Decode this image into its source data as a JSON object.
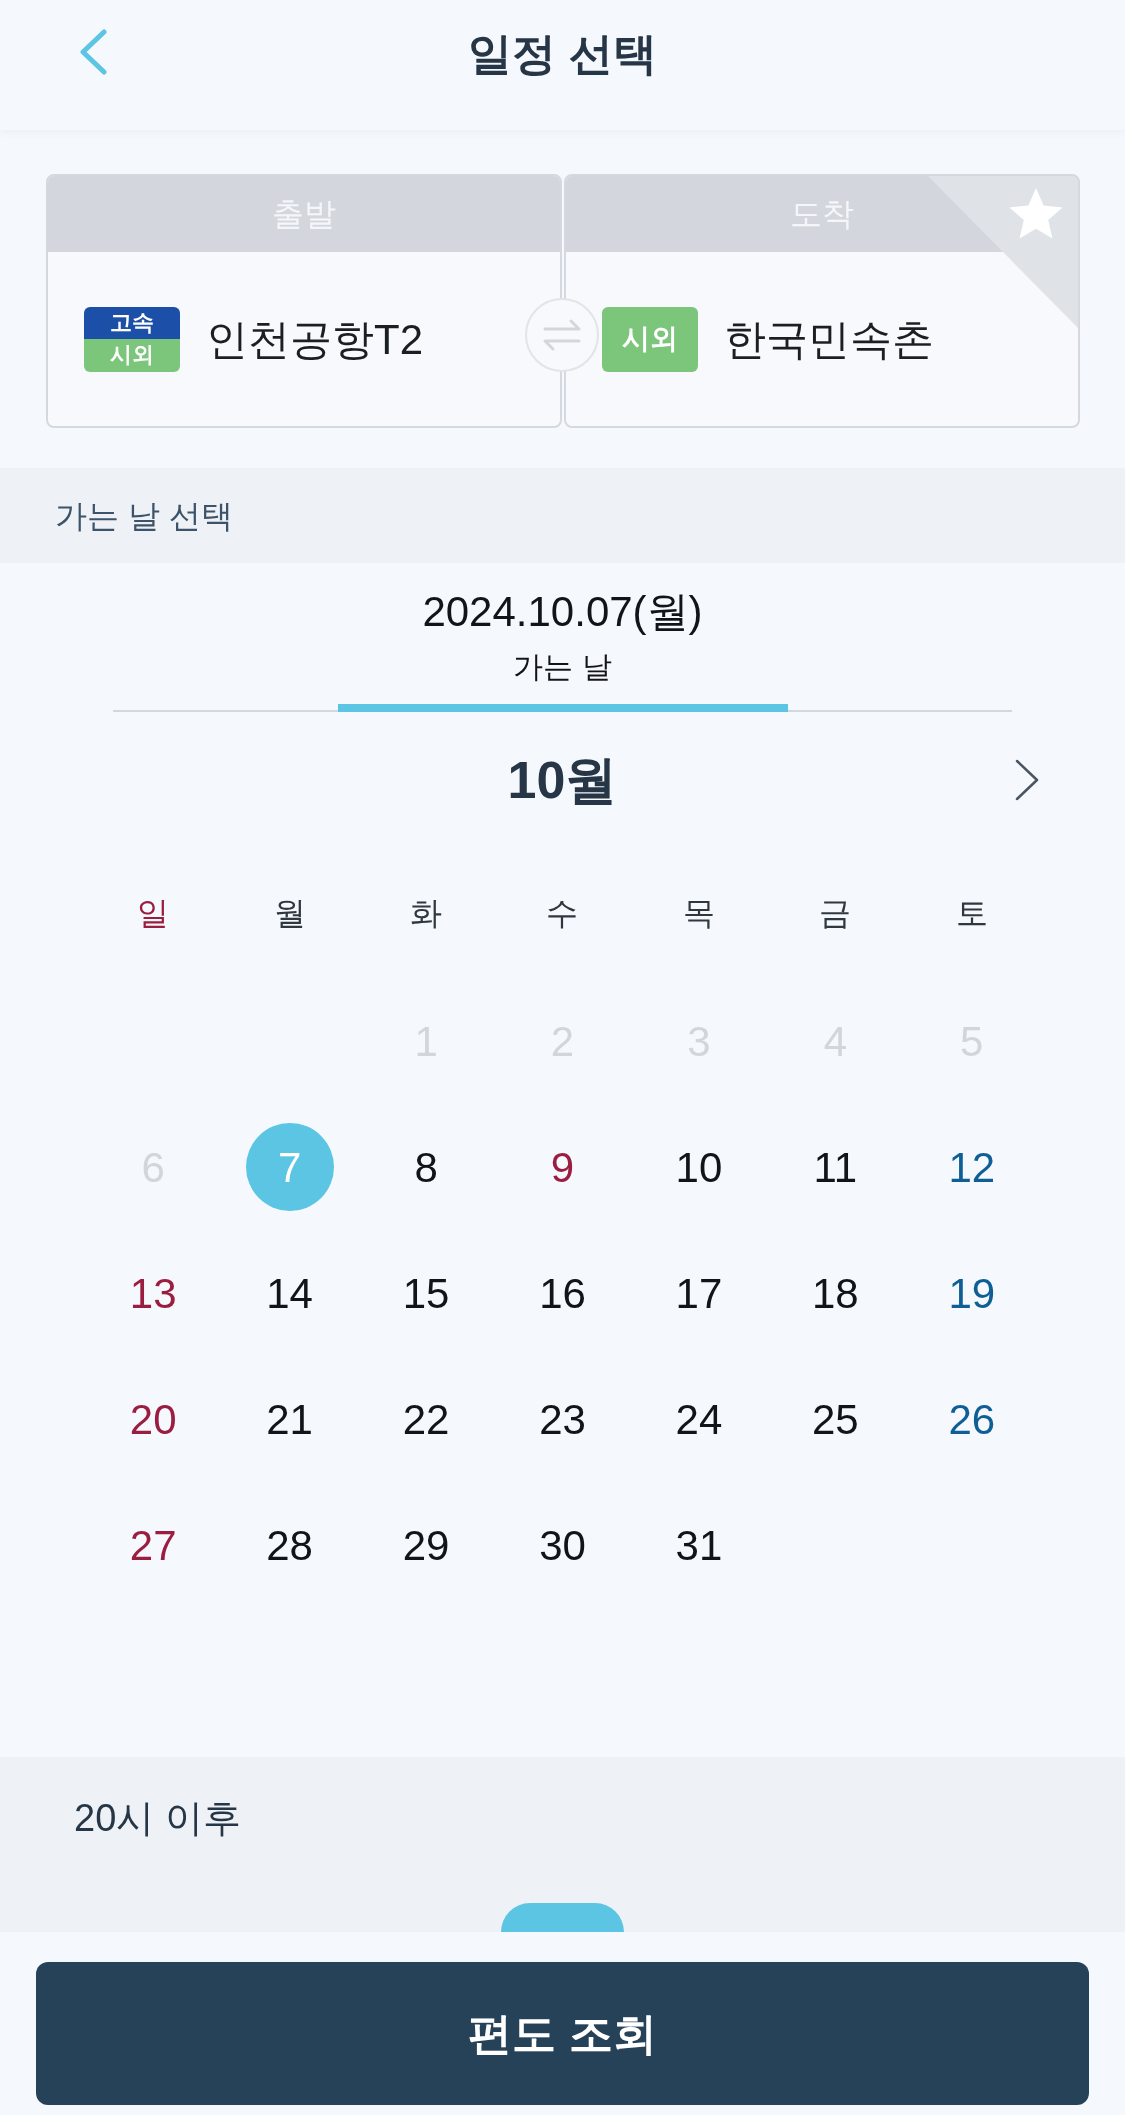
{
  "header": {
    "title": "일정 선택"
  },
  "route": {
    "departure": {
      "header": "출발",
      "name": "인천공항T2",
      "badges": [
        {
          "label": "고속",
          "color": "#1c4fa8"
        },
        {
          "label": "시외",
          "color": "#7cc67b"
        }
      ]
    },
    "arrival": {
      "header": "도착",
      "name": "한국민속촌",
      "badges": [
        {
          "label": "시외",
          "color": "#7cc67b"
        }
      ]
    },
    "favorite": false
  },
  "date_section": {
    "title": "가는 날 선택"
  },
  "date_tabs": [
    {
      "date": "2024.10.07(월)",
      "label": "가는 날",
      "selected": true
    }
  ],
  "calendar": {
    "month": "10월",
    "weekdays": [
      {
        "label": "일",
        "kind": "sunday"
      },
      {
        "label": "월",
        "kind": "weekday"
      },
      {
        "label": "화",
        "kind": "weekday"
      },
      {
        "label": "수",
        "kind": "weekday"
      },
      {
        "label": "목",
        "kind": "weekday"
      },
      {
        "label": "금",
        "kind": "weekday"
      },
      {
        "label": "토",
        "kind": "weekday"
      }
    ],
    "weeks": [
      {
        "days": [
          {
            "day": "1",
            "kind": "past",
            "selected": false
          },
          {
            "day": "2",
            "kind": "past",
            "selected": false
          },
          {
            "day": "3",
            "kind": "past",
            "selected": false
          },
          {
            "day": "4",
            "kind": "past",
            "selected": false
          },
          {
            "day": "5",
            "kind": "past",
            "selected": false
          }
        ]
      },
      {
        "days": [
          {
            "day": "6",
            "kind": "past",
            "selected": false
          },
          {
            "day": "7",
            "kind": "weekday",
            "selected": true
          },
          {
            "day": "8",
            "kind": "weekday",
            "selected": false
          },
          {
            "day": "9",
            "kind": "holiday",
            "selected": false
          },
          {
            "day": "10",
            "kind": "weekday",
            "selected": false
          },
          {
            "day": "11",
            "kind": "weekday",
            "selected": false
          },
          {
            "day": "12",
            "kind": "saturday",
            "selected": false
          }
        ]
      },
      {
        "days": [
          {
            "day": "13",
            "kind": "sunday",
            "selected": false
          },
          {
            "day": "14",
            "kind": "weekday",
            "selected": false
          },
          {
            "day": "15",
            "kind": "weekday",
            "selected": false
          },
          {
            "day": "16",
            "kind": "weekday",
            "selected": false
          },
          {
            "day": "17",
            "kind": "weekday",
            "selected": false
          },
          {
            "day": "18",
            "kind": "weekday",
            "selected": false
          },
          {
            "day": "19",
            "kind": "saturday",
            "selected": false
          }
        ]
      },
      {
        "days": [
          {
            "day": "20",
            "kind": "sunday",
            "selected": false
          },
          {
            "day": "21",
            "kind": "weekday",
            "selected": false
          },
          {
            "day": "22",
            "kind": "weekday",
            "selected": false
          },
          {
            "day": "23",
            "kind": "weekday",
            "selected": false
          },
          {
            "day": "24",
            "kind": "weekday",
            "selected": false
          },
          {
            "day": "25",
            "kind": "weekday",
            "selected": false
          },
          {
            "day": "26",
            "kind": "saturday",
            "selected": false
          }
        ]
      },
      {
        "days": [
          {
            "day": "27",
            "kind": "sunday",
            "selected": false
          },
          {
            "day": "28",
            "kind": "weekday",
            "selected": false
          },
          {
            "day": "29",
            "kind": "weekday",
            "selected": false
          },
          {
            "day": "30",
            "kind": "weekday",
            "selected": false
          },
          {
            "day": "31",
            "kind": "weekday",
            "selected": false
          }
        ]
      }
    ]
  },
  "time_section": {
    "title": "20시 이후"
  },
  "time_chips": [
    {
      "selected": true
    }
  ],
  "search_button": {
    "label": "편도 조회"
  }
}
